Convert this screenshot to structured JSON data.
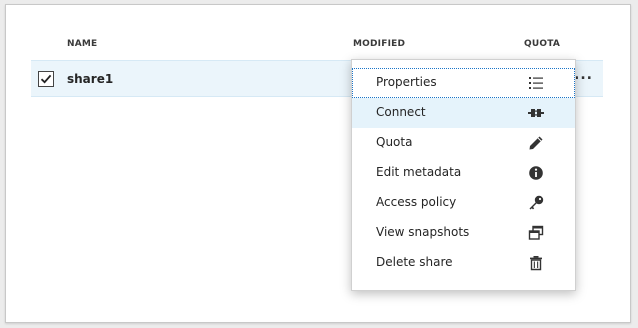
{
  "table": {
    "columns": {
      "name": "NAME",
      "modified": "MODIFIED",
      "quota": "QUOTA"
    },
    "rows": [
      {
        "name": "share1",
        "selected": true
      }
    ],
    "more_label": "..."
  },
  "context_menu": {
    "items": [
      {
        "label": "Properties",
        "icon": "list-icon"
      },
      {
        "label": "Connect",
        "icon": "connect-icon"
      },
      {
        "label": "Quota",
        "icon": "pencil-icon"
      },
      {
        "label": "Edit metadata",
        "icon": "info-icon"
      },
      {
        "label": "Access policy",
        "icon": "key-icon"
      },
      {
        "label": "View snapshots",
        "icon": "snapshots-icon"
      },
      {
        "label": "Delete share",
        "icon": "trash-icon"
      }
    ]
  },
  "colors": {
    "row_selected": "#ebf5fb",
    "menu_hover": "#e5f3fb",
    "focus_outline": "#1a75c9"
  }
}
